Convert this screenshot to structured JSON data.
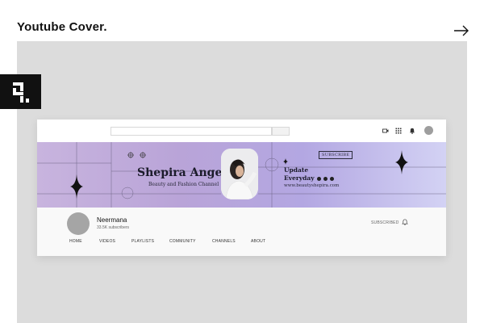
{
  "page": {
    "heading": "Youtube Cover."
  },
  "icons": {
    "next": "arrow-right-icon",
    "logo": "brand-logo",
    "topbar": [
      "video-camera-icon",
      "apps-grid-icon",
      "bell-icon"
    ],
    "channel": "bell-icon"
  },
  "banner": {
    "title": "Shepira Angel",
    "tagline": "Beauty and Fashion Channel",
    "subscribe_tag": "SUBSCRIBE",
    "update_line1": "Update",
    "update_line2": "Everyday",
    "url": "www.beautyshepira.com",
    "gradient": [
      "#c8b4de",
      "#b9a4d8",
      "#b3a7e2",
      "#d3d2f4"
    ]
  },
  "channel": {
    "name": "Neermana",
    "subscribers": "33.5K subscribers",
    "subscribed_label": "SUBSCRIBED"
  },
  "tabs": [
    "HOME",
    "VIDEOS",
    "PLAYLISTS",
    "COMMUNITY",
    "CHANNELS",
    "ABOUT"
  ],
  "colors": {
    "stage": "#dcdcdc",
    "logo": "#111111",
    "avatar": "#a5a5a5"
  }
}
